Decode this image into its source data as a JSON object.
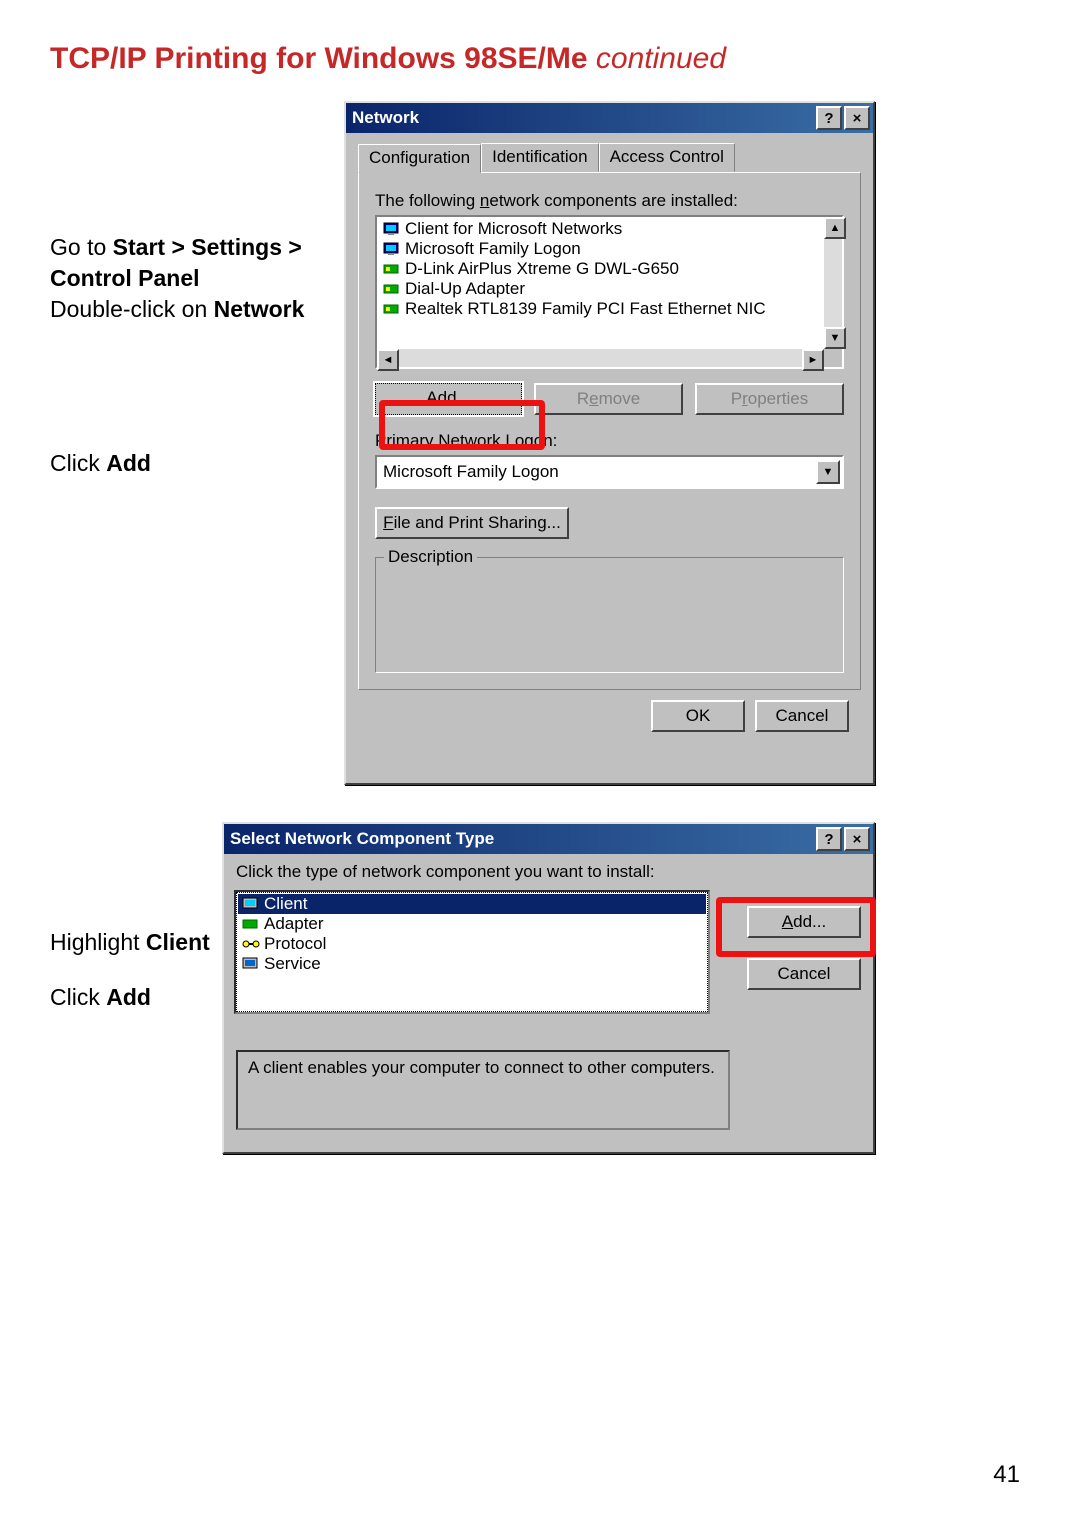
{
  "page": {
    "title_main": "TCP/IP Printing for Windows 98SE/Me",
    "title_cont": " continued",
    "number": "41"
  },
  "instructions": {
    "i1_a": "Go to ",
    "i1_b": "Start > Settings > Control Panel",
    "i2_a": "Double-click on ",
    "i2_b": "Network",
    "i3_a": "Click ",
    "i3_b": "Add",
    "i4_a": "Highlight ",
    "i4_b": "Client",
    "i5_a": "Click ",
    "i5_b": "Add"
  },
  "dialog_network": {
    "title": "Network",
    "tabs": [
      "Configuration",
      "Identification",
      "Access Control"
    ],
    "active_tab": 0,
    "components_label_pre": "The following ",
    "components_label_u": "n",
    "components_label_post": "etwork components are installed:",
    "components": [
      "Client for Microsoft Networks",
      "Microsoft Family Logon",
      "D-Link AirPlus Xtreme G DWL-G650",
      "Dial-Up Adapter",
      "Realtek RTL8139 Family PCI Fast Ethernet NIC"
    ],
    "btn_add": "Add...",
    "btn_remove": "Remove",
    "btn_properties": "Properties",
    "logon_label_pre": "Primary Network ",
    "logon_label_u": "L",
    "logon_label_post": "ogon:",
    "logon_value": "Microsoft Family Logon",
    "btn_file_share_pre": "",
    "btn_file_share_u": "F",
    "btn_file_share_post": "ile and Print Sharing...",
    "group_desc": "Description",
    "btn_ok": "OK",
    "btn_cancel": "Cancel"
  },
  "dialog_select": {
    "title": "Select Network Component Type",
    "prompt": "Click the type of network component you want to install:",
    "items": [
      "Client",
      "Adapter",
      "Protocol",
      "Service"
    ],
    "selected_index": 0,
    "btn_add": "Add...",
    "btn_cancel": "Cancel",
    "desc": "A client enables your computer to connect to other computers."
  },
  "icons": {
    "help": "?",
    "close": "×",
    "up": "▲",
    "down": "▼",
    "left": "◄",
    "right": "►",
    "dd": "▼"
  }
}
